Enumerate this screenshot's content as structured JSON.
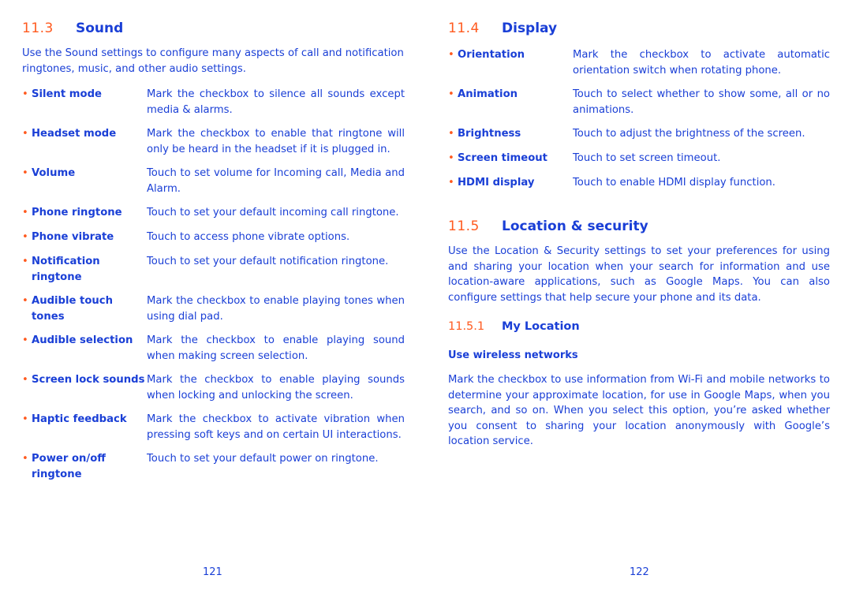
{
  "left_page": {
    "section": {
      "number": "11.3",
      "title": "Sound"
    },
    "intro": "Use the Sound settings to configure many aspects of call and notification ringtones, music, and other audio settings.",
    "items": [
      {
        "term": "Silent mode",
        "desc": "Mark the checkbox to silence all sounds except media & alarms."
      },
      {
        "term": "Headset mode",
        "desc": "Mark the checkbox to enable that ringtone will only be heard in the headset if it is plugged in."
      },
      {
        "term": "Volume",
        "desc": "Touch to set volume for Incoming call, Media and Alarm."
      },
      {
        "term": "Phone ringtone",
        "desc": "Touch to set your default incoming call ringtone."
      },
      {
        "term": "Phone vibrate",
        "desc": "Touch to access phone vibrate options."
      },
      {
        "term": "Notification ringtone",
        "desc": "Touch to set your default notification ringtone."
      },
      {
        "term": "Audible touch tones",
        "desc": "Mark the checkbox to enable playing tones when using dial pad."
      },
      {
        "term": "Audible selection",
        "desc": "Mark the checkbox to enable playing sound when making screen selection."
      },
      {
        "term": "Screen lock sounds",
        "desc": "Mark the checkbox to enable playing sounds when locking and unlocking the screen."
      },
      {
        "term": "Haptic feedback",
        "desc": "Mark the checkbox to activate vibration when pressing soft keys and on certain UI interactions."
      },
      {
        "term": "Power on/off ringtone",
        "desc": "Touch to set your default power on ringtone."
      }
    ],
    "page_number": "121"
  },
  "right_page": {
    "display_section": {
      "number": "11.4",
      "title": "Display"
    },
    "display_items": [
      {
        "term": "Orientation",
        "desc": "Mark the checkbox to activate automatic orientation switch when rotating phone."
      },
      {
        "term": "Animation",
        "desc": "Touch to select whether to show some, all or no animations."
      },
      {
        "term": "Brightness",
        "desc": "Touch to adjust the brightness of the screen."
      },
      {
        "term": "Screen timeout",
        "desc": "Touch to set screen timeout."
      },
      {
        "term": "HDMI display",
        "desc": "Touch to enable HDMI display function."
      }
    ],
    "location_section": {
      "number": "11.5",
      "title": "Location & security"
    },
    "location_intro": "Use the Location & Security settings to set your preferences for using and sharing your location when your search for information and use location-aware applications, such as Google Maps. You can also configure settings that help secure your phone and its data.",
    "subsection": {
      "number": "11.5.1",
      "title": "My Location"
    },
    "subheading": "Use wireless networks",
    "subsection_body": "Mark the checkbox to use information from Wi-Fi and mobile networks to determine your approximate location, for use in Google Maps, when you search, and so on. When you select this option, you’re asked whether you consent to sharing your location anonymously with Google’s location service.",
    "page_number": "122"
  },
  "bullet_glyph": "•",
  "colors": {
    "text": "#1a3fd6",
    "accent": "#ff5a1f",
    "background": "#ffffff"
  }
}
